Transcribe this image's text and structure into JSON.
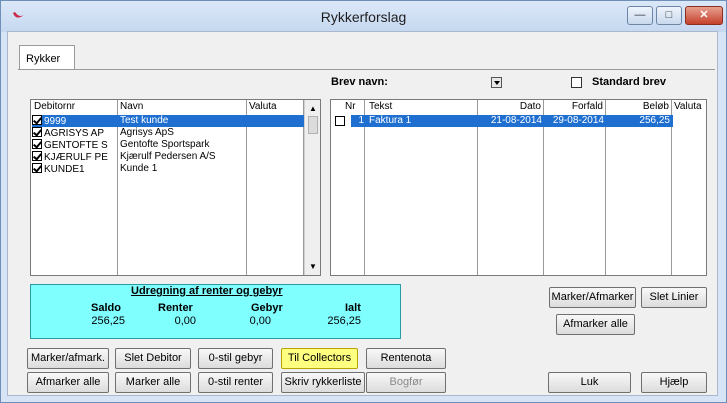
{
  "window": {
    "title": "Rykkerforslag",
    "minimize": "—",
    "maximize": "□",
    "close": "✕"
  },
  "tab": {
    "label": "Rykker"
  },
  "brev": {
    "label": "Brev navn:",
    "standard_label": "Standard brev"
  },
  "debitor_list": {
    "columns": [
      "Debitornr",
      "Navn",
      "Valuta"
    ],
    "rows": [
      {
        "nr": "9999",
        "navn": "Test kunde",
        "checked": true,
        "selected": true
      },
      {
        "nr": "AGRISYS AP",
        "navn": "Agrisys ApS",
        "checked": true,
        "selected": false
      },
      {
        "nr": "GENTOFTE S",
        "navn": "Gentofte Sportspark",
        "checked": true,
        "selected": false
      },
      {
        "nr": "KJÆRULF PE",
        "navn": "Kjærulf Pedersen A/S",
        "checked": true,
        "selected": false
      },
      {
        "nr": "KUNDE1",
        "navn": "Kunde 1",
        "checked": true,
        "selected": false
      }
    ]
  },
  "faktura_list": {
    "columns": [
      "Nr",
      "Tekst",
      "Dato",
      "Forfald",
      "Beløb",
      "Valuta"
    ],
    "rows": [
      {
        "nr": "1",
        "tekst": "Faktura 1",
        "dato": "21-08-2014",
        "forfald": "29-08-2014",
        "belob": "256,25",
        "valuta": ""
      }
    ]
  },
  "calc": {
    "title": "Udregning af renter og gebyr",
    "saldo_label": "Saldo",
    "saldo": "256,25",
    "renter_label": "Renter",
    "renter": "0,00",
    "gebyr_label": "Gebyr",
    "gebyr": "0,00",
    "ialt_label": "Ialt",
    "ialt": "256,25"
  },
  "right_buttons": {
    "marker_afmarker": "Marker/Afmarker",
    "slet_linier": "Slet Linier",
    "afmarker_alle": "Afmarker alle"
  },
  "bottom_buttons": {
    "marker_afmark": "Marker/afmark.",
    "slet_debitor": "Slet Debitor",
    "nul_gebyr": "0-stil gebyr",
    "til_collectors": "Til Collectors",
    "rentenota": "Rentenota",
    "afmarker_alle": "Afmarker alle",
    "marker_alle": "Marker alle",
    "nul_renter": "0-stil renter",
    "skriv_rykkerliste": "Skriv rykkerliste",
    "bogfor": "Bogfør",
    "luk": "Luk",
    "hjaelp": "Hjælp"
  },
  "colors": {
    "selection": "#1f6fd1",
    "calc_bg": "#80ffff",
    "highlight_button": "#ffff80"
  }
}
